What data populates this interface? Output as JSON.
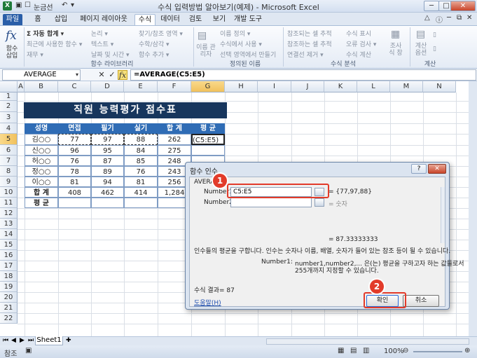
{
  "window": {
    "title": "수식 입력방법 알아보기(예제) - Microsoft Excel",
    "qat_label": "눈금선",
    "minimize": "─",
    "maximize": "□",
    "close": "✕"
  },
  "tabs": [
    "파일",
    "홈",
    "삽입",
    "페이지 레이아웃",
    "수식",
    "데이터",
    "검토",
    "보기",
    "개발 도구"
  ],
  "ribbon": {
    "insert_function": "함수 삽입",
    "library": {
      "autosum": "Σ 자동 합계 ▾",
      "recent": "최근에 사용한 함수 ▾",
      "finance": "재무 ▾",
      "logical": "논리 ▾",
      "text": "텍스트 ▾",
      "datetime": "날짜 및 시간 ▾",
      "lookup": "찾기/참조 영역 ▾",
      "math": "수학/삼각 ▾",
      "more": "함수 추가 ▾",
      "group_label": "함수 라이브러리"
    },
    "names": {
      "manager": "이름 관리자",
      "define": "이름 정의 ▾",
      "use_in_formula": "수식에서 사용 ▾",
      "create_from_selection": "선택 영역에서 만들기",
      "group_label": "정의된 이름"
    },
    "auditing": {
      "trace_precedents": "참조되는 셀 추적",
      "trace_dependents": "참조하는 셀 추적",
      "remove_arrows": "연결선 제거 ▾",
      "show_formulas": "수식 표시",
      "error_checking": "오류 검사 ▾",
      "evaluate": "수식 계산",
      "watch": "조사식 창",
      "group_label": "수식 분석"
    },
    "calculation": {
      "options": "계산 옵션",
      "group_label": "계산"
    }
  },
  "formula_bar": {
    "name_box": "AVERAGE",
    "cancel": "✕",
    "enter": "✓",
    "fx": "fx",
    "formula": "=AVERAGE(C5:E5)"
  },
  "columns": [
    "A",
    "B",
    "C",
    "D",
    "E",
    "F",
    "G",
    "H",
    "I",
    "J",
    "K",
    "L",
    "M",
    "N"
  ],
  "rows": [
    "1",
    "2",
    "3",
    "4",
    "5",
    "6",
    "7",
    "8",
    "9",
    "10",
    "11",
    "12",
    "13",
    "14",
    "15",
    "16",
    "17",
    "18",
    "19",
    "20",
    "21",
    "22"
  ],
  "sheet": {
    "title": "직원 능력평가 점수표",
    "headers": [
      "성명",
      "면접",
      "필기",
      "실기",
      "합 계",
      "평 균"
    ],
    "data_rows": [
      [
        "김○○",
        "77",
        "97",
        "88",
        "262",
        "(C5:E5)"
      ],
      [
        "신○○",
        "96",
        "95",
        "84",
        "275",
        ""
      ],
      [
        "허○○",
        "76",
        "87",
        "85",
        "248",
        ""
      ],
      [
        "정○○",
        "78",
        "89",
        "76",
        "243",
        ""
      ],
      [
        "이○○",
        "81",
        "94",
        "81",
        "256",
        ""
      ]
    ],
    "total_row": [
      "합 계",
      "408",
      "462",
      "414",
      "1,284",
      ""
    ],
    "avg_row": [
      "평 균",
      "",
      "",
      "",
      "",
      ""
    ]
  },
  "dialog": {
    "title": "함수 인수",
    "help_btn": "?",
    "close_btn": "✕",
    "func_name": "AVERAGE",
    "arg1_label": "Number1",
    "arg1_value": "C5:E5",
    "arg1_result": "= {77,97,88}",
    "arg2_label": "Number2",
    "arg2_result": "= 숫자",
    "result_line": "= 87.33333333",
    "description": "인수들의 평균을 구합니다. 인수는 숫자나 이름, 배열, 숫자가 들어 있는 참조 등이 될 수 있습니다.",
    "arg_help_label": "Number1:",
    "arg_help_1": "number1,number2,... 은(는) 평균을 구하고자 하는 값들로서",
    "arg_help_2": "255개까지 지정할 수 있습니다.",
    "formula_result": "수식 결과= 87",
    "help_link": "도움말(H)",
    "ok": "확인",
    "cancel": "취소",
    "badge1": "1",
    "badge2": "2"
  },
  "sheet_tab": "Sheet1",
  "status": {
    "mode": "참조",
    "zoom": "100%"
  }
}
